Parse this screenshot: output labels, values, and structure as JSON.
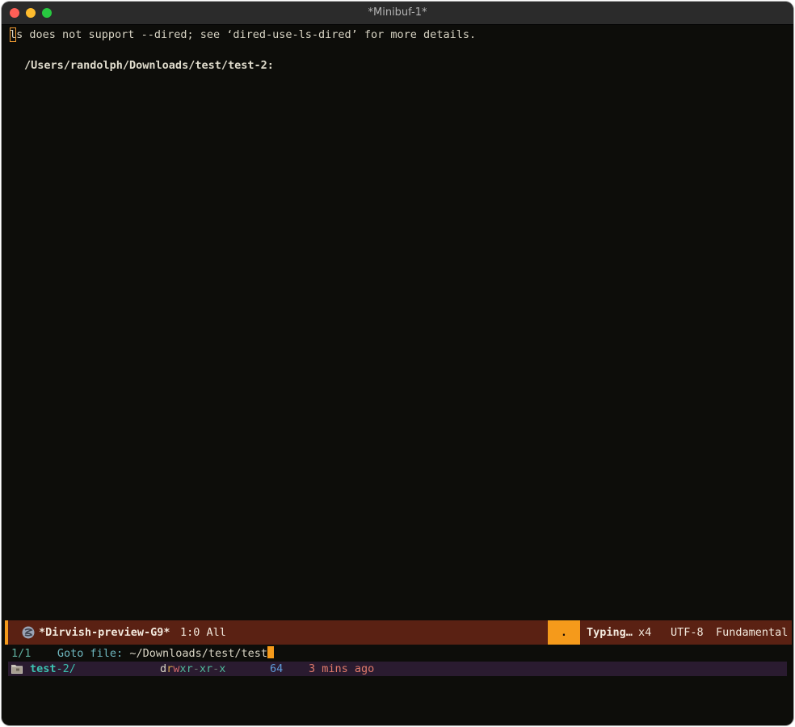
{
  "window": {
    "title": "*Minibuf-1*"
  },
  "buffer": {
    "cursor_char": "l",
    "message_rest": "s does not support --dired; see ‘dired-use-ls-dired’ for more details.",
    "directory_heading": "/Users/randolph/Downloads/test/test-2:"
  },
  "modeline": {
    "buffer_name": "*Dirvish-preview-G9*",
    "position": "1:0 All",
    "box_char": ".",
    "typing": "Typing…",
    "count": "x4",
    "encoding": "UTF-8",
    "major_mode": "Fundamental",
    "colors": {
      "background": "#5a2113",
      "accent": "#f59a1b"
    }
  },
  "minibuffer": {
    "count": "1/1",
    "prompt": "Goto file: ",
    "input": "~/Downloads/test/test"
  },
  "candidate": {
    "icon": "folder-icon",
    "name_match": "test",
    "name_rest": "-2/",
    "permissions": {
      "type": "d",
      "owner_r": "r",
      "owner_w": "w",
      "owner_x": "x",
      "group_r": "r",
      "group_w": "-",
      "group_x": "x",
      "other_r": "r",
      "other_w": "-",
      "other_x": "x"
    },
    "size": "64",
    "modified": "3 mins ago"
  }
}
